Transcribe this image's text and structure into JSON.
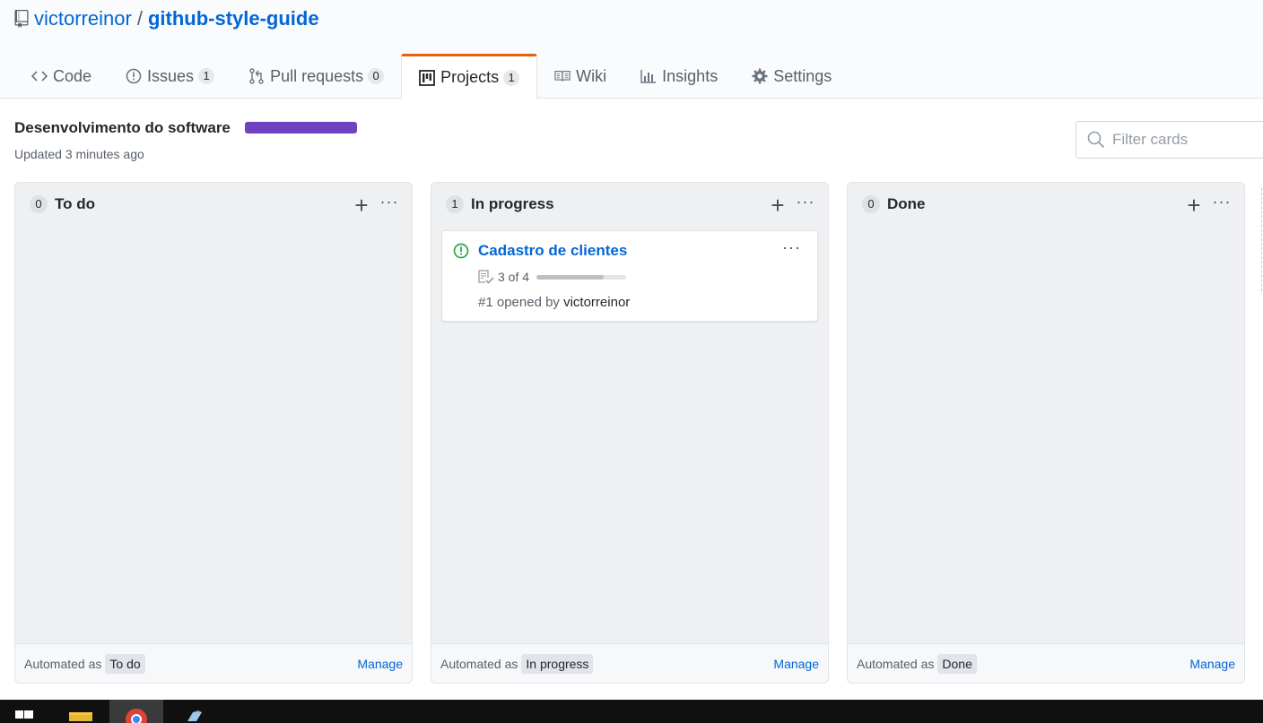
{
  "repo": {
    "owner": "victorreinor",
    "separator": "/",
    "name": "github-style-guide"
  },
  "tabs": [
    {
      "label": "Code",
      "icon": "code-icon"
    },
    {
      "label": "Issues",
      "count": "1",
      "icon": "issue-icon"
    },
    {
      "label": "Pull requests",
      "count": "0",
      "icon": "pull-request-icon"
    },
    {
      "label": "Projects",
      "count": "1",
      "icon": "project-icon",
      "selected": true
    },
    {
      "label": "Wiki",
      "icon": "book-icon"
    },
    {
      "label": "Insights",
      "icon": "graph-icon"
    },
    {
      "label": "Settings",
      "icon": "gear-icon"
    }
  ],
  "project": {
    "name": "Desenvolvimento do software",
    "updated": "Updated 3 minutes ago",
    "progress_color": "#6f42c1"
  },
  "filter": {
    "placeholder": "Filter cards"
  },
  "columns": [
    {
      "count": "0",
      "title": "To do",
      "automated_label": "Automated as",
      "automated_value": "To do",
      "manage": "Manage"
    },
    {
      "count": "1",
      "title": "In progress",
      "automated_label": "Automated as",
      "automated_value": "In progress",
      "manage": "Manage",
      "card": {
        "title": "Cadastro de clientes",
        "tasks": "3 of 4",
        "tasks_done_fraction": 0.75,
        "meta_prefix": "#1 opened by",
        "author": "victorreinor"
      }
    },
    {
      "count": "0",
      "title": "Done",
      "automated_label": "Automated as",
      "automated_value": "Done",
      "manage": "Manage"
    }
  ],
  "colors": {
    "link": "#0366d6",
    "selected_tab_accent": "#e36209",
    "open_issue": "#28a745"
  }
}
